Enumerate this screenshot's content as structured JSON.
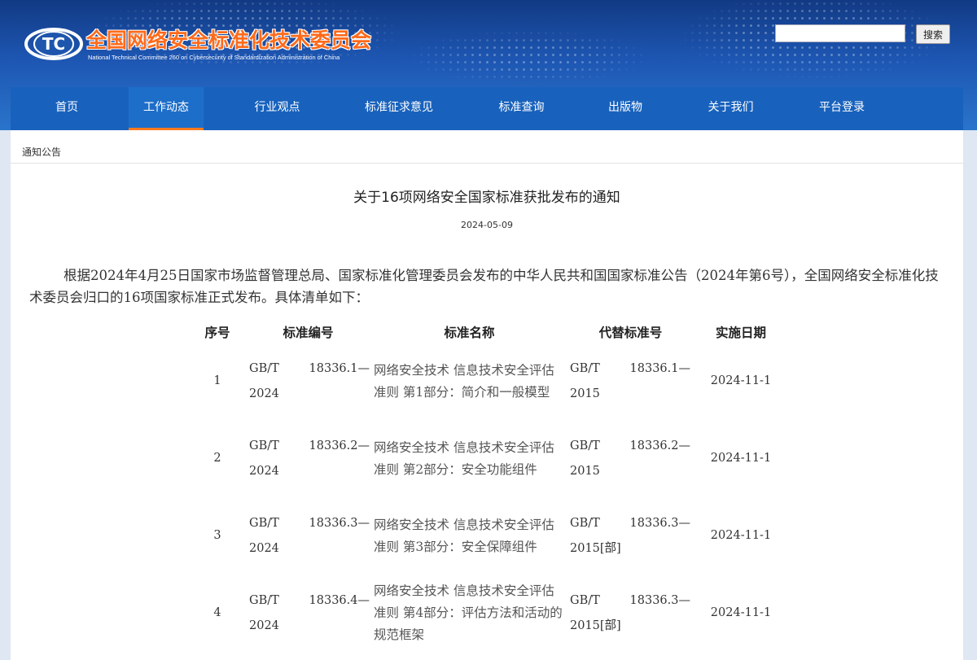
{
  "header": {
    "logo_text": "TC",
    "site_title": "全国网络安全标准化技术委员会",
    "site_subtitle": "National Technical Committee 260 on Cybersecurity of Standardization Administration of China",
    "search_placeholder": "",
    "search_button": "搜索",
    "colors": {
      "title": "#ff6a1a",
      "band_top": "#123a84",
      "nav": "#1862bd",
      "active_underline": "#ff7a1c"
    }
  },
  "nav": {
    "items": [
      {
        "label": "首页"
      },
      {
        "label": "工作动态",
        "active": true
      },
      {
        "label": "行业观点"
      },
      {
        "label": "标准征求意见"
      },
      {
        "label": "标准查询"
      },
      {
        "label": "出版物"
      },
      {
        "label": "关于我们"
      },
      {
        "label": "平台登录"
      }
    ]
  },
  "breadcrumb": "通知公告",
  "article": {
    "title": "关于16项网络安全国家标准获批发布的通知",
    "date": "2024-05-09",
    "body": "根据2024年4月25日国家市场监督管理总局、国家标准化管理委员会发布的中华人民共和国国家标准公告（2024年第6号），全国网络安全标准化技术委员会归口的16项国家标准正式发布。具体清单如下："
  },
  "table": {
    "headers": [
      "序号",
      "标准编号",
      "标准名称",
      "代替标准号",
      "实施日期"
    ],
    "rows": [
      {
        "no": "1",
        "code_a": "GB/T",
        "code_b": "18336.1—",
        "code_c": "2024",
        "name": "网络安全技术 信息技术安全评估准则 第1部分：简介和一般模型",
        "rep_a": "GB/T",
        "rep_b": "18336.1—",
        "rep_c": "2015",
        "date": "2024-11-1"
      },
      {
        "no": "2",
        "code_a": "GB/T",
        "code_b": "18336.2—",
        "code_c": "2024",
        "name": "网络安全技术 信息技术安全评估准则 第2部分：安全功能组件",
        "rep_a": "GB/T",
        "rep_b": "18336.2—",
        "rep_c": "2015",
        "date": "2024-11-1"
      },
      {
        "no": "3",
        "code_a": "GB/T",
        "code_b": "18336.3—",
        "code_c": "2024",
        "name": "网络安全技术 信息技术安全评估准则 第3部分：安全保障组件",
        "rep_a": "GB/T",
        "rep_b": "18336.3—",
        "rep_c": "2015[部]",
        "date": "2024-11-1"
      },
      {
        "no": "4",
        "code_a": "GB/T",
        "code_b": "18336.4—",
        "code_c": "2024",
        "name": "网络安全技术 信息技术安全评估准则 第4部分：评估方法和活动的规范框架",
        "rep_a": "GB/T",
        "rep_b": "18336.3—",
        "rep_c": "2015[部]",
        "date": "2024-11-1"
      }
    ]
  }
}
